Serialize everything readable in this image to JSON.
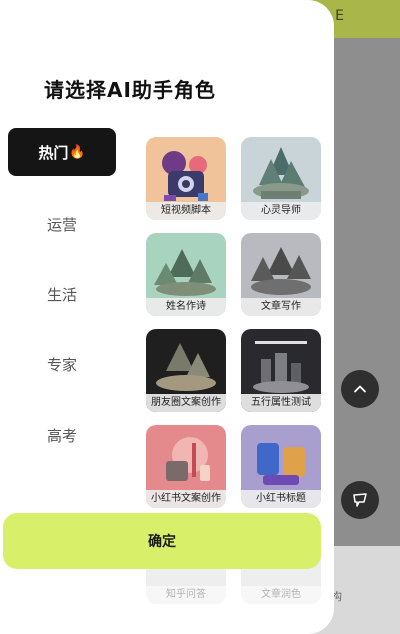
{
  "background": {
    "topbar_text": "E",
    "lower_text": "构"
  },
  "drawer": {
    "title": "请选择AI助手角色",
    "categories": [
      {
        "label": "热门",
        "badge": "🔥",
        "active": true
      },
      {
        "label": "运营",
        "active": false
      },
      {
        "label": "生活",
        "active": false
      },
      {
        "label": "专家",
        "active": false
      },
      {
        "label": "高考",
        "active": false
      }
    ],
    "cards": [
      {
        "label": "短视频脚本"
      },
      {
        "label": "心灵导师"
      },
      {
        "label": "姓名作诗"
      },
      {
        "label": "文章写作"
      },
      {
        "label": "朋友圈文案创作"
      },
      {
        "label": "五行属性测试"
      },
      {
        "label": "小红书文案创作"
      },
      {
        "label": "小红书标题"
      },
      {
        "label": "知乎问答"
      },
      {
        "label": "文章润色"
      }
    ],
    "confirm_label": "确定"
  },
  "colors": {
    "accent": "#d8ef6a",
    "active_category_bg": "#151515",
    "topbar": "#a9b64a"
  },
  "icons": {
    "scroll_up": "chevron-up-icon",
    "chat": "chat-bubble-icon"
  }
}
